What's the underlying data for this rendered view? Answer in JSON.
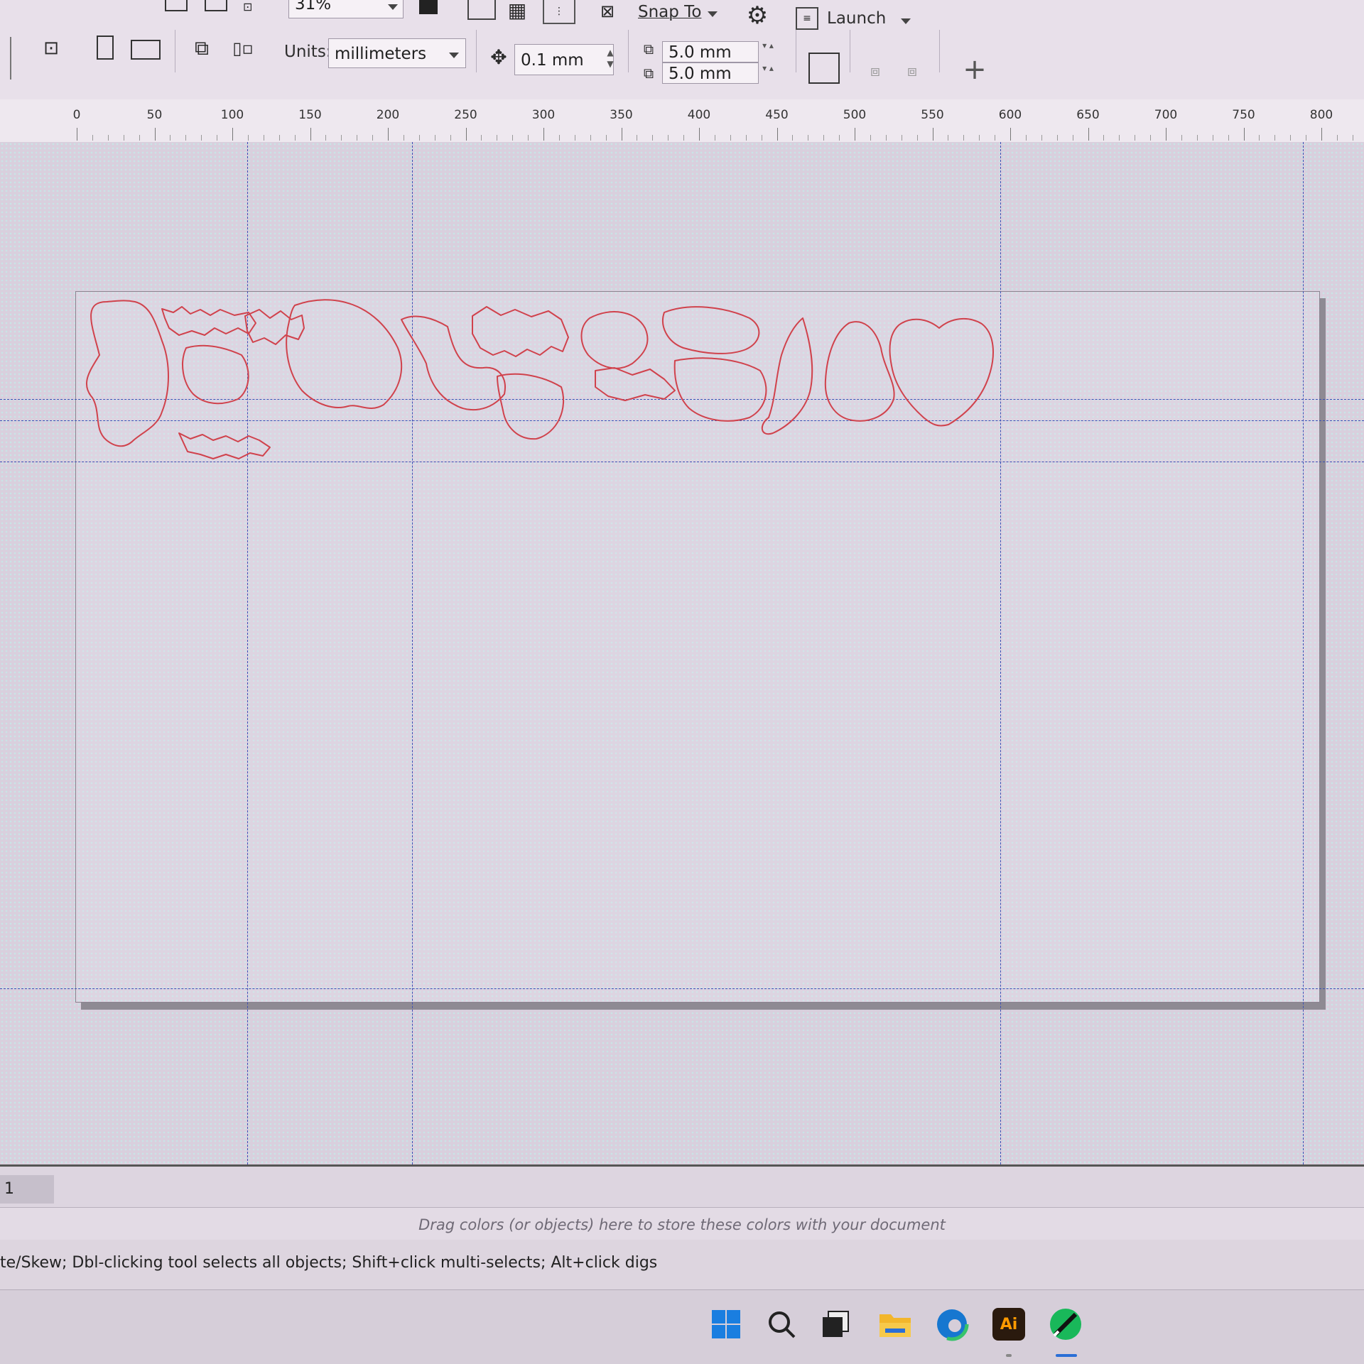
{
  "toolbar": {
    "zoom_value": "31%",
    "snap_label": "Snap To",
    "launch_label": "Launch",
    "units_label": "Units:",
    "units_value": "millimeters",
    "nudge_value": "0.1 mm",
    "dup_x_value": "5.0 mm",
    "dup_y_value": "5.0 mm",
    "add_icon": "+"
  },
  "ruler": {
    "labels": [
      "0",
      "50",
      "100",
      "150",
      "200",
      "250",
      "300",
      "350",
      "400",
      "450",
      "500",
      "550",
      "600",
      "650",
      "700",
      "750",
      "800"
    ]
  },
  "page_tabs": {
    "current_page": "1"
  },
  "palette": {
    "hint": "Drag colors (or objects) here to store these colors with your document"
  },
  "status": {
    "text": "te/Skew; Dbl-clicking tool selects all objects; Shift+click multi-selects; Alt+click digs"
  },
  "taskbar": {
    "illustrator_label": "Ai"
  },
  "colors": {
    "outline": "#d0424c",
    "guides": "#3b4fb5",
    "accent_green": "#19b85a"
  }
}
